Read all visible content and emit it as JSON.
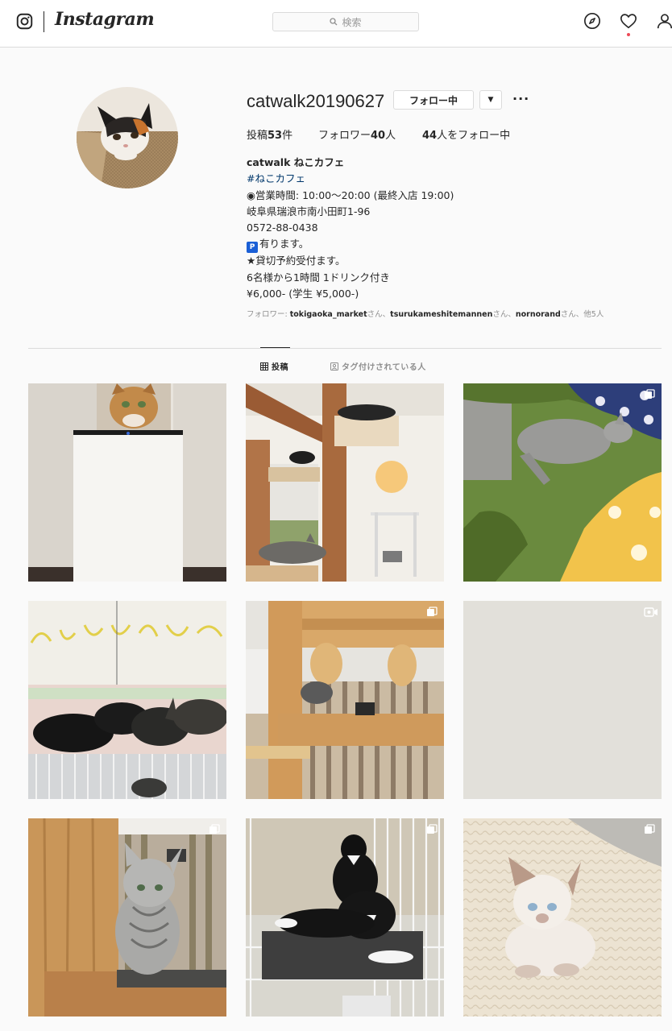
{
  "topbar": {
    "wordmark": "Instagram",
    "search_placeholder": "検索",
    "icons": [
      "instagram-glyph-icon",
      "search-icon",
      "compass-icon",
      "heart-icon",
      "profile-icon"
    ],
    "notification_color": "#ed4956"
  },
  "profile": {
    "username": "catwalk20190627",
    "follow_button": "フォロー中",
    "dropdown_symbol": "▼",
    "more_symbol": "···",
    "stats": {
      "posts_label": "投稿",
      "posts_count": "53",
      "posts_suffix": "件",
      "followers_label": "フォロワー",
      "followers_count": "40",
      "followers_suffix": "人",
      "following_count": "44",
      "following_suffix": "人をフォロー中"
    },
    "bio": {
      "name": "catwalk ねこカフェ",
      "hashtag": "#ねこカフェ",
      "hours": "◉営業時間: 10:00〜20:00 (最終入店 19:00)",
      "address": "岐阜県瑞浪市南小田町1-96",
      "phone": "0572-88-0438",
      "parking_badge": "P",
      "parking": "有ります。",
      "charter": "★貸切予約受付ます。",
      "plan": "6名様から1時間 1ドリンク付き",
      "price": "¥6,000- (学生 ¥5,000-)"
    },
    "followed_by": {
      "prefix": "フォロワー: ",
      "user1": "tokigaoka_market",
      "sep1": "さん、",
      "user2": "tsurukameshitemannen",
      "sep2": "さん、",
      "user3": "nornorand",
      "suffix": "さん、他5人"
    }
  },
  "tabs": {
    "posts": "投稿",
    "tagged": "タグ付けされている人"
  },
  "posts": [
    {
      "id": 1,
      "multi": false,
      "video": false
    },
    {
      "id": 2,
      "multi": false,
      "video": false
    },
    {
      "id": 3,
      "multi": true,
      "video": false
    },
    {
      "id": 4,
      "multi": false,
      "video": false
    },
    {
      "id": 5,
      "multi": true,
      "video": false
    },
    {
      "id": 6,
      "multi": false,
      "video": true
    },
    {
      "id": 7,
      "multi": true,
      "video": false
    },
    {
      "id": 8,
      "multi": true,
      "video": false
    },
    {
      "id": 9,
      "multi": true,
      "video": false
    }
  ]
}
